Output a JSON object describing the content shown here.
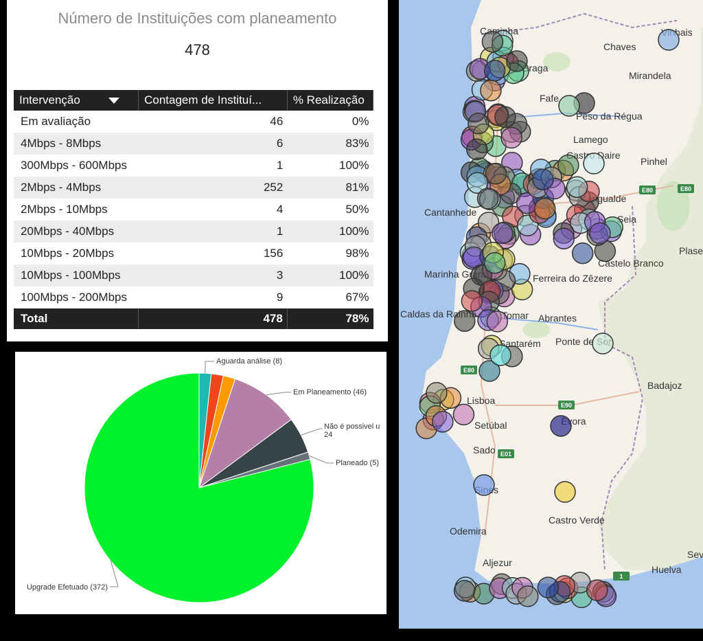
{
  "card": {
    "title": "Número de Instituições com planeamento",
    "value": "478"
  },
  "table": {
    "columns": [
      "Intervenção",
      "Contagem de Instituí...",
      "% Realização"
    ],
    "rows": [
      [
        "Em avaliação",
        "46",
        "0%"
      ],
      [
        "4Mbps - 8Mbps",
        "6",
        "83%"
      ],
      [
        "300Mbps - 600Mbps",
        "1",
        "100%"
      ],
      [
        "2Mbps - 4Mbps",
        "252",
        "81%"
      ],
      [
        "2Mbps - 10Mbps",
        "4",
        "50%"
      ],
      [
        "20Mbps - 40Mbps",
        "1",
        "100%"
      ],
      [
        "10Mbps - 20Mbps",
        "156",
        "98%"
      ],
      [
        "10Mbps - 100Mbps",
        "3",
        "100%"
      ],
      [
        "100Mbps - 200Mbps",
        "9",
        "67%"
      ]
    ],
    "total": [
      "Total",
      "478",
      "78%"
    ]
  },
  "chart_data": {
    "type": "pie",
    "slices": [
      {
        "label": "",
        "value": 8,
        "color": "#1fb8b0"
      },
      {
        "label": "",
        "value": 8,
        "color": "#f0461e"
      },
      {
        "label": "",
        "value": 8,
        "color": "#ff9a00"
      },
      {
        "label": "Em Planeamento (46)",
        "value": 46,
        "color": "#b580a8"
      },
      {
        "label": "Não é possivel u\n24",
        "value": 24,
        "color": "#374448"
      },
      {
        "label": "Planeado (5)",
        "value": 5,
        "color": "#66717a"
      },
      {
        "label": "Upgrade Efetuado (372)",
        "value": 372,
        "color": "#00f02c"
      }
    ],
    "extra_labels": [
      "Aguarda análise (8)"
    ]
  },
  "map": {
    "places": [
      "Caminha",
      "Chaves",
      "Vinhais",
      "Braga",
      "Mirandela",
      "Fafe",
      "Peso da Régua",
      "Lamego",
      "Castro Daire",
      "Pinhel",
      "Mangualde",
      "Cantanhede",
      "Seia",
      "Castelo Branco",
      "Plasencia",
      "Marinha Grande",
      "Ferreira do Zêzere",
      "Caldas da Rainha",
      "Tomar",
      "Abrantes",
      "Santarém",
      "Ponte de Sor",
      "Lisboa",
      "Setúbal",
      "Sado",
      "Badajoz",
      "Évora",
      "Sines",
      "Castro Verde",
      "Odemira",
      "Aljezur",
      "Huelva",
      "Sevilla"
    ],
    "roads": [
      "E80",
      "E80",
      "E80",
      "E90",
      "E01",
      "1"
    ]
  }
}
